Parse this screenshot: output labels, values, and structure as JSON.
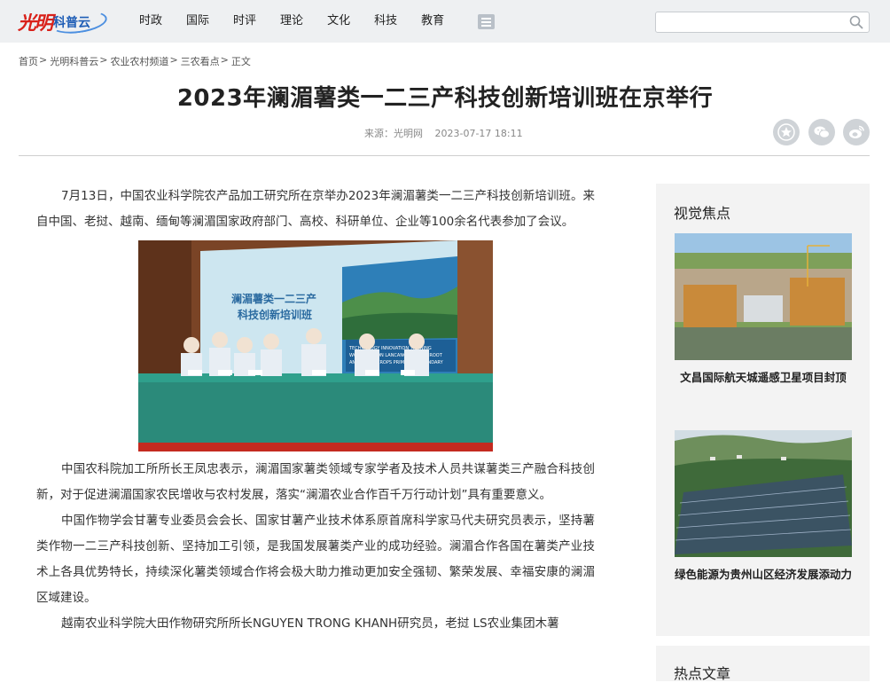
{
  "header": {
    "logo_main": "光明",
    "logo_sub": "科普云",
    "nav": [
      "时政",
      "国际",
      "时评",
      "理论",
      "文化",
      "科技",
      "教育"
    ],
    "search": {
      "value": "",
      "placeholder": ""
    }
  },
  "breadcrumb": [
    "首页",
    "光明科普云",
    "农业农村频道",
    "三农看点",
    "正文"
  ],
  "article": {
    "title": "2023年澜湄薯类一二三产科技创新培训班在京举行",
    "source": "来源：光明网",
    "datetime": "2023-07-17 18:11",
    "paragraphs_top": [
      "7月13日，中国农业科学院农产品加工研究所在京举办2023年澜湄薯类一二三产科技创新培训班。来自中国、老挝、越南、缅甸等澜湄国家政府部门、高校、科研单位、企业等100余名代表参加了会议。"
    ],
    "photo": {
      "banner_cn": "澜湄薯类一二三产\n科技创新培训班",
      "banner_en": "TECHNOLOGY INNOVATION TRAINING WORKSHOP ON LANCANG-MEKONG ROOT AND TUBER CROPS PRIMARY, SECONDARY AND TERTIARY INDUSTRIES"
    },
    "paragraphs_bottom": [
      "中国农科院加工所所长王凤忠表示，澜湄国家薯类领域专家学者及技术人员共谋薯类三产融合科技创新，对于促进澜湄国家农民增收与农村发展，落实“澜湄农业合作百千万行动计划”具有重要意义。",
      "中国作物学会甘薯专业委员会会长、国家甘薯产业技术体系原首席科学家马代夫研究员表示，坚持薯类作物一二三产科技创新、坚持加工引领，是我国发展薯类产业的成功经验。澜湄合作各国在薯类产业技术上各具优势特长，持续深化薯类领域合作将会极大助力推动更加安全强韧、繁荣发展、幸福安康的澜湄区域建设。",
      "越南农业科学院大田作物研究所所长NGUYEN TRONG KHANH研究员，老挝 LS农业集团木薯"
    ]
  },
  "sidebar": {
    "heading": "视觉焦点",
    "cards": [
      {
        "caption": "文昌国际航天城遥感卫星项目封顶"
      },
      {
        "caption": "绿色能源为贵州山区经济发展添动力"
      }
    ],
    "heading2": "热点文章"
  }
}
